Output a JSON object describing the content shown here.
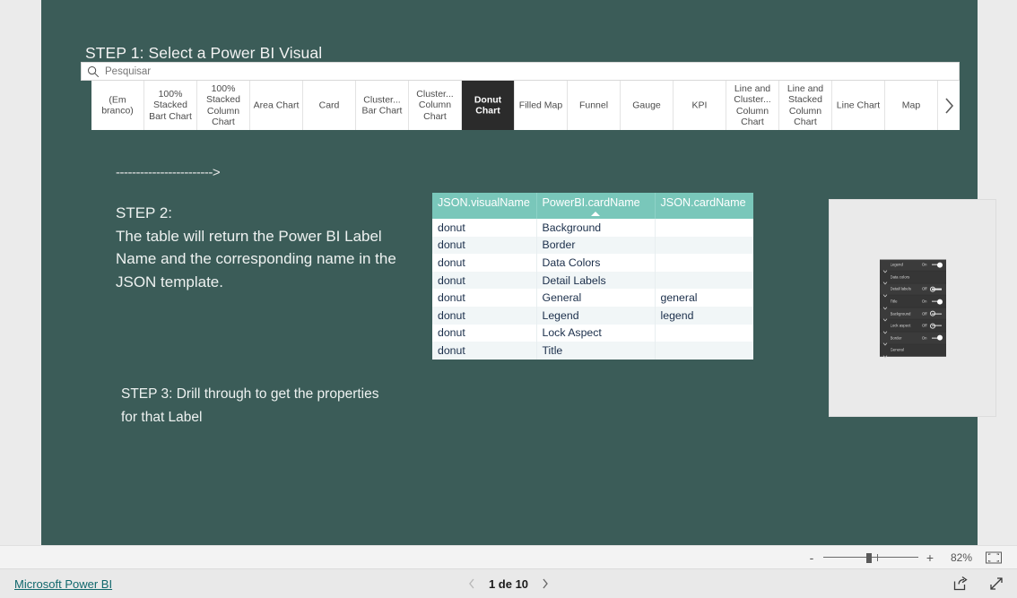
{
  "slide": {
    "step1_title": "STEP 1: Select a Power BI Visual",
    "dashed_arrow": "------------------------>",
    "step2_text": "STEP 2:\nThe table will return the Power BI Label Name and the corresponding name in the JSON template.",
    "step3_text": "STEP 3: Drill through to get the properties for that Label",
    "background_color": "#3b5c58"
  },
  "slicer": {
    "search_placeholder": "Pesquisar",
    "search_value": "",
    "search_icon": "search-icon",
    "next_icon": "chevron-right-icon",
    "selected": "Donut Chart",
    "tiles": [
      {
        "label": "(Em branco)",
        "selected": false
      },
      {
        "label": "100% Stacked Bart Chart",
        "selected": false
      },
      {
        "label": "100% Stacked Column Chart",
        "selected": false
      },
      {
        "label": "Area Chart",
        "selected": false
      },
      {
        "label": "Card",
        "selected": false
      },
      {
        "label": "Cluster... Bar Chart",
        "selected": false
      },
      {
        "label": "Cluster... Column Chart",
        "selected": false
      },
      {
        "label": "Donut Chart",
        "selected": true
      },
      {
        "label": "Filled Map",
        "selected": false
      },
      {
        "label": "Funnel",
        "selected": false
      },
      {
        "label": "Gauge",
        "selected": false
      },
      {
        "label": "KPI",
        "selected": false
      },
      {
        "label": "Line and Cluster... Column Chart",
        "selected": false
      },
      {
        "label": "Line and Stacked Column Chart",
        "selected": false
      },
      {
        "label": "Line Chart",
        "selected": false
      },
      {
        "label": "Map",
        "selected": false
      }
    ]
  },
  "table": {
    "headers": [
      "JSON.visualName",
      "PowerBI.cardName",
      "JSON.cardName"
    ],
    "sorted_column_index": 1,
    "sort_direction": "ascending",
    "header_color": "#79c7ba",
    "rows": [
      [
        "donut",
        "Background",
        ""
      ],
      [
        "donut",
        "Border",
        ""
      ],
      [
        "donut",
        "Data Colors",
        ""
      ],
      [
        "donut",
        "Detail Labels",
        ""
      ],
      [
        "donut",
        "General",
        "general"
      ],
      [
        "donut",
        "Legend",
        "legend"
      ],
      [
        "donut",
        "Lock Aspect",
        ""
      ],
      [
        "donut",
        "Title",
        ""
      ]
    ]
  },
  "format_pane_image": {
    "rows": [
      {
        "name": "Legend",
        "state": "On",
        "has_toggle": true
      },
      {
        "name": "Data colors",
        "state": "",
        "has_toggle": false
      },
      {
        "name": "Detail labels",
        "state": "Off",
        "has_toggle": true
      },
      {
        "name": "Title",
        "state": "On",
        "has_toggle": true
      },
      {
        "name": "Background",
        "state": "Off",
        "has_toggle": true
      },
      {
        "name": "Lock aspect",
        "state": "Off",
        "has_toggle": true
      },
      {
        "name": "Border",
        "state": "On",
        "has_toggle": true
      },
      {
        "name": "General",
        "state": "",
        "has_toggle": false
      }
    ]
  },
  "status": {
    "zoom_minus": "-",
    "zoom_plus": "+",
    "zoom_percent": "82%",
    "fit_icon": "fit-to-screen-icon"
  },
  "bottom": {
    "brand": "Microsoft Power BI",
    "prev_icon": "chevron-left-icon",
    "next_icon": "chevron-right-icon",
    "page_label": "1 de 10",
    "share_icon": "share-icon",
    "fullscreen_icon": "fullscreen-icon"
  }
}
